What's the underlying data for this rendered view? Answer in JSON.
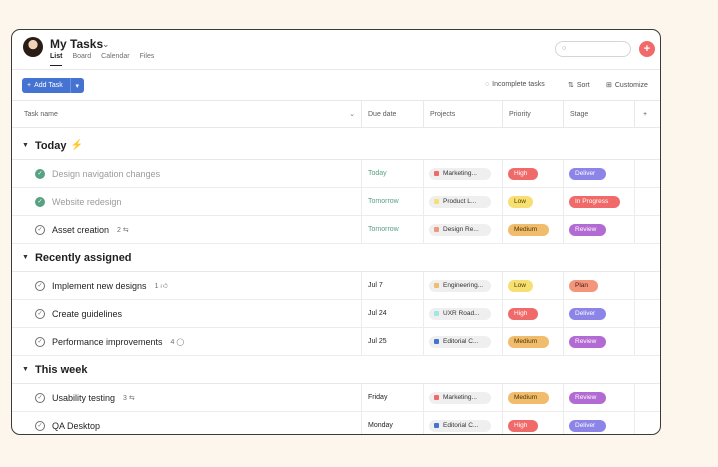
{
  "header": {
    "title": "My Tasks",
    "tabs": [
      "List",
      "Board",
      "Calendar",
      "Files"
    ]
  },
  "toolbar": {
    "add_task": "Add Task",
    "incomplete": "Incomplete tasks",
    "sort": "Sort",
    "customize": "Customize"
  },
  "columns": {
    "name": "Task name",
    "due": "Due date",
    "projects": "Projects",
    "priority": "Priority",
    "stage": "Stage",
    "add": "+"
  },
  "sections": [
    {
      "title": "Today"
    },
    {
      "title": "Recently assigned"
    },
    {
      "title": "This week"
    }
  ],
  "tasks": [
    {
      "name": "Design navigation changes",
      "meta": "",
      "due": "Today",
      "project": "Marketing...",
      "project_color": "#f06a6a",
      "priority": "High",
      "stage": "Deliver"
    },
    {
      "name": "Website redesign",
      "meta": "",
      "due": "Tomorrow",
      "project": "Product L...",
      "project_color": "#f8df72",
      "priority": "Low",
      "stage": "In Progress"
    },
    {
      "name": "Asset creation",
      "meta": "2",
      "due": "Tomorrow",
      "project": "Design Re...",
      "project_color": "#f3967c",
      "priority": "Medium",
      "stage": "Review"
    },
    {
      "name": "Implement new designs",
      "meta": "1",
      "due": "Jul 7",
      "project": "Engineering...",
      "project_color": "#f1bd6c",
      "priority": "Low",
      "stage": "Plan"
    },
    {
      "name": "Create guidelines",
      "meta": "",
      "due": "Jul 24",
      "project": "UXR Road...",
      "project_color": "#9ee7e3",
      "priority": "High",
      "stage": "Deliver"
    },
    {
      "name": "Performance improvements",
      "meta": "4",
      "due": "Jul 25",
      "project": "Editorial C...",
      "project_color": "#4573d2",
      "priority": "Medium",
      "stage": "Review"
    },
    {
      "name": "Usability testing",
      "meta": "3",
      "due": "Friday",
      "project": "Marketing...",
      "project_color": "#f06a6a",
      "priority": "Medium",
      "stage": "Review"
    },
    {
      "name": "QA Desktop",
      "meta": "",
      "due": "Monday",
      "project": "Editorial C...",
      "project_color": "#4573d2",
      "priority": "High",
      "stage": "Deliver"
    }
  ],
  "colors": {
    "accent_blue": "#4573d2",
    "brand_coral": "#f06a6a",
    "done_green": "#58a182"
  }
}
